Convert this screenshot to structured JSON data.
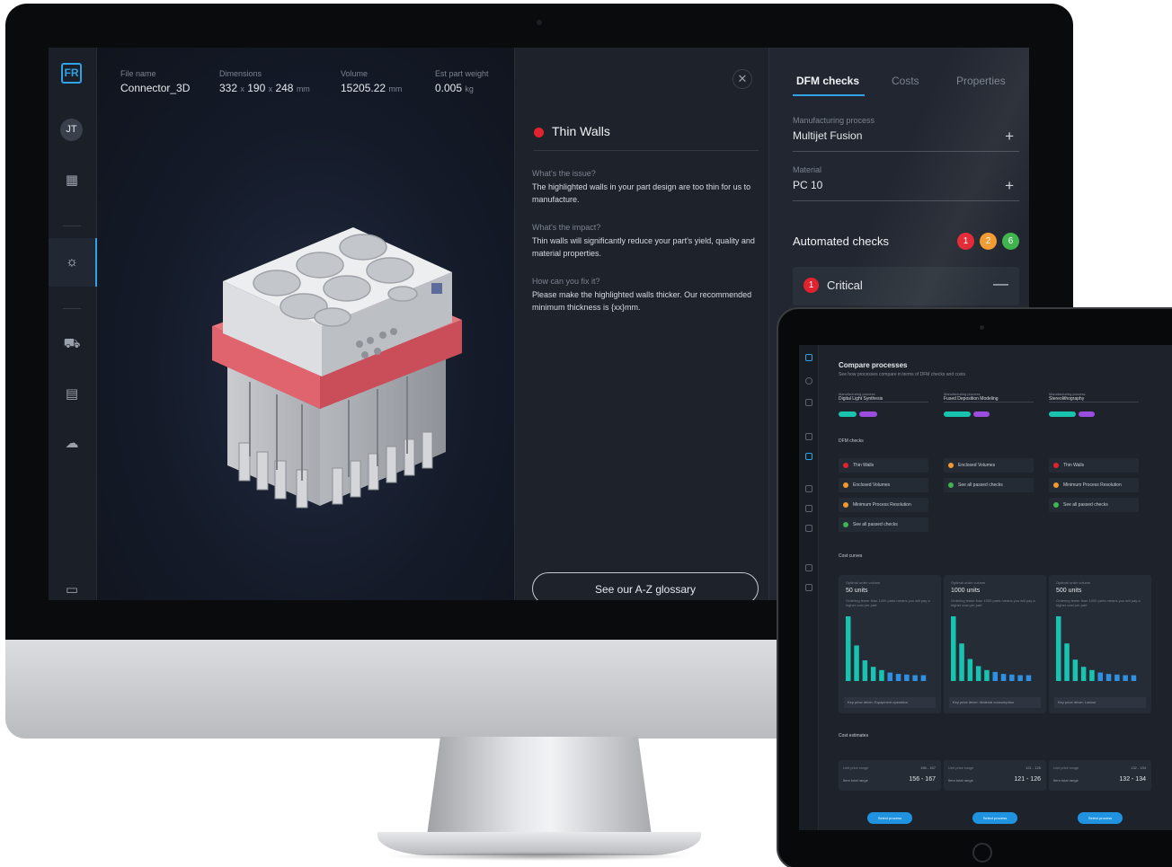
{
  "brand": {
    "accent": "#2fa3e6",
    "critical": "#e2232f",
    "warning": "#f29a2e",
    "passed": "#3fb54e",
    "teal": "#18c3b0",
    "purple": "#9b4de0"
  },
  "nav": {
    "logo_text": "FR",
    "avatar": "JT",
    "icons": [
      "layout-icon",
      "lightbulb-icon",
      "cart-icon",
      "invoice-icon",
      "cloud-icon",
      "chat-icon"
    ]
  },
  "file": {
    "name_label": "File name",
    "name": "Connector_3D",
    "dim_label": "Dimensions",
    "dim_a": "332",
    "dim_b": "190",
    "dim_c": "248",
    "dim_sep": "x",
    "dim_unit": "mm",
    "vol_label": "Volume",
    "vol": "15205.22",
    "vol_unit": "mm",
    "weight_label": "Est part weight",
    "weight": "0.005",
    "weight_unit": "kg"
  },
  "issue": {
    "close": "✕",
    "title": "Thin Walls",
    "q1": "What's the issue?",
    "a1": "The highlighted walls in your part design are too thin for us to manufacture.",
    "q2": "What's the impact?",
    "a2": "Thin walls will significantly reduce your part's yield, quality and material properties.",
    "q3": "How can you fix it?",
    "a3": "Please make the highlighted walls thicker. Our recommended minimum thickness is {xx}mm.",
    "glossary": "See our A-Z glossary"
  },
  "panel": {
    "tabs": [
      "DFM checks",
      "Costs",
      "Properties"
    ],
    "process_label": "Manufacturing process",
    "process": "Multijet Fusion",
    "material_label": "Material",
    "material": "PC 10",
    "plus": "+",
    "auto_title": "Automated checks",
    "counts": [
      "1",
      "2",
      "6"
    ],
    "critical_count": "1",
    "critical_label": "Critical",
    "minus": "—"
  },
  "tablet": {
    "title": "Compare processes",
    "subtitle": "See how processes compare in terms of DFM checks and costs",
    "col_label": "Manufacturing process",
    "processes": [
      "Digital Light Synthesis",
      "Fused Deposition Modeling",
      "Stereolithography"
    ],
    "dfm_label": "DFM checks",
    "checks": [
      [
        {
          "t": "Thin Walls",
          "c": "critical"
        },
        {
          "t": "Enclosed Volumes",
          "c": "warning"
        },
        {
          "t": "Minimum Process Resolution",
          "c": "warning"
        },
        {
          "t": "See all passed checks",
          "c": "passed"
        }
      ],
      [
        {
          "t": "Enclosed Volumes",
          "c": "warning"
        },
        {
          "t": "See all passed checks",
          "c": "passed"
        }
      ],
      [
        {
          "t": "Thin Walls",
          "c": "critical"
        },
        {
          "t": "Minimum Process Resolution",
          "c": "warning"
        },
        {
          "t": "See all passed checks",
          "c": "passed"
        }
      ]
    ],
    "cost_curves_label": "Cost curves",
    "card_caption": "Optimal order volume",
    "units": [
      "50 units",
      "1000 units",
      "500 units"
    ],
    "card_note": "Ordering fewer than 1000 parts means you will pay a higher cost per part",
    "drivers": [
      "Equipment operation",
      "Material consumption",
      "Labour"
    ],
    "driver_prefix": "Key price driver:",
    "bars": [
      [
        1.0,
        0.55,
        0.32,
        0.22,
        0.17,
        0.13,
        0.11,
        0.1,
        0.09,
        0.09
      ],
      [
        1.0,
        0.58,
        0.34,
        0.23,
        0.17,
        0.14,
        0.11,
        0.1,
        0.09,
        0.09
      ],
      [
        1.0,
        0.58,
        0.33,
        0.22,
        0.17,
        0.13,
        0.11,
        0.1,
        0.09,
        0.09
      ]
    ],
    "estimates_label": "Cost estimates",
    "unit_price_label": "Unit price range",
    "total_label": "Item total range",
    "estimates": [
      {
        "unit": "156 - 167",
        "total": "156 - 167"
      },
      {
        "unit": "121 - 126",
        "total": "121 - 126"
      },
      {
        "unit": "132 - 134",
        "total": "132 - 134"
      }
    ],
    "select": "Select process"
  }
}
